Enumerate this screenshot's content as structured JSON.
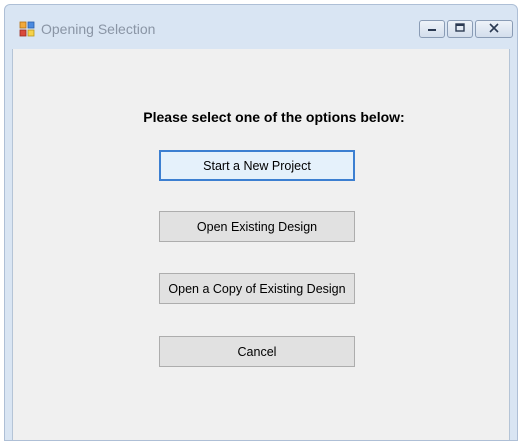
{
  "window": {
    "title": "Opening Selection"
  },
  "icons": {
    "app": "app-window-icon",
    "minimize": "minimize-icon",
    "maximize": "maximize-icon",
    "close": "close-icon"
  },
  "dialog": {
    "prompt": "Please select one of the options below:",
    "buttons": {
      "new_project": "Start a New Project",
      "open_existing": "Open Existing Design",
      "open_copy": "Open a Copy of Existing Design",
      "cancel": "Cancel"
    },
    "default_button": "new_project"
  },
  "colors": {
    "focus_border": "#3c7fd1",
    "client_background": "#f0f0f0",
    "frame": "#d9e5f3"
  }
}
